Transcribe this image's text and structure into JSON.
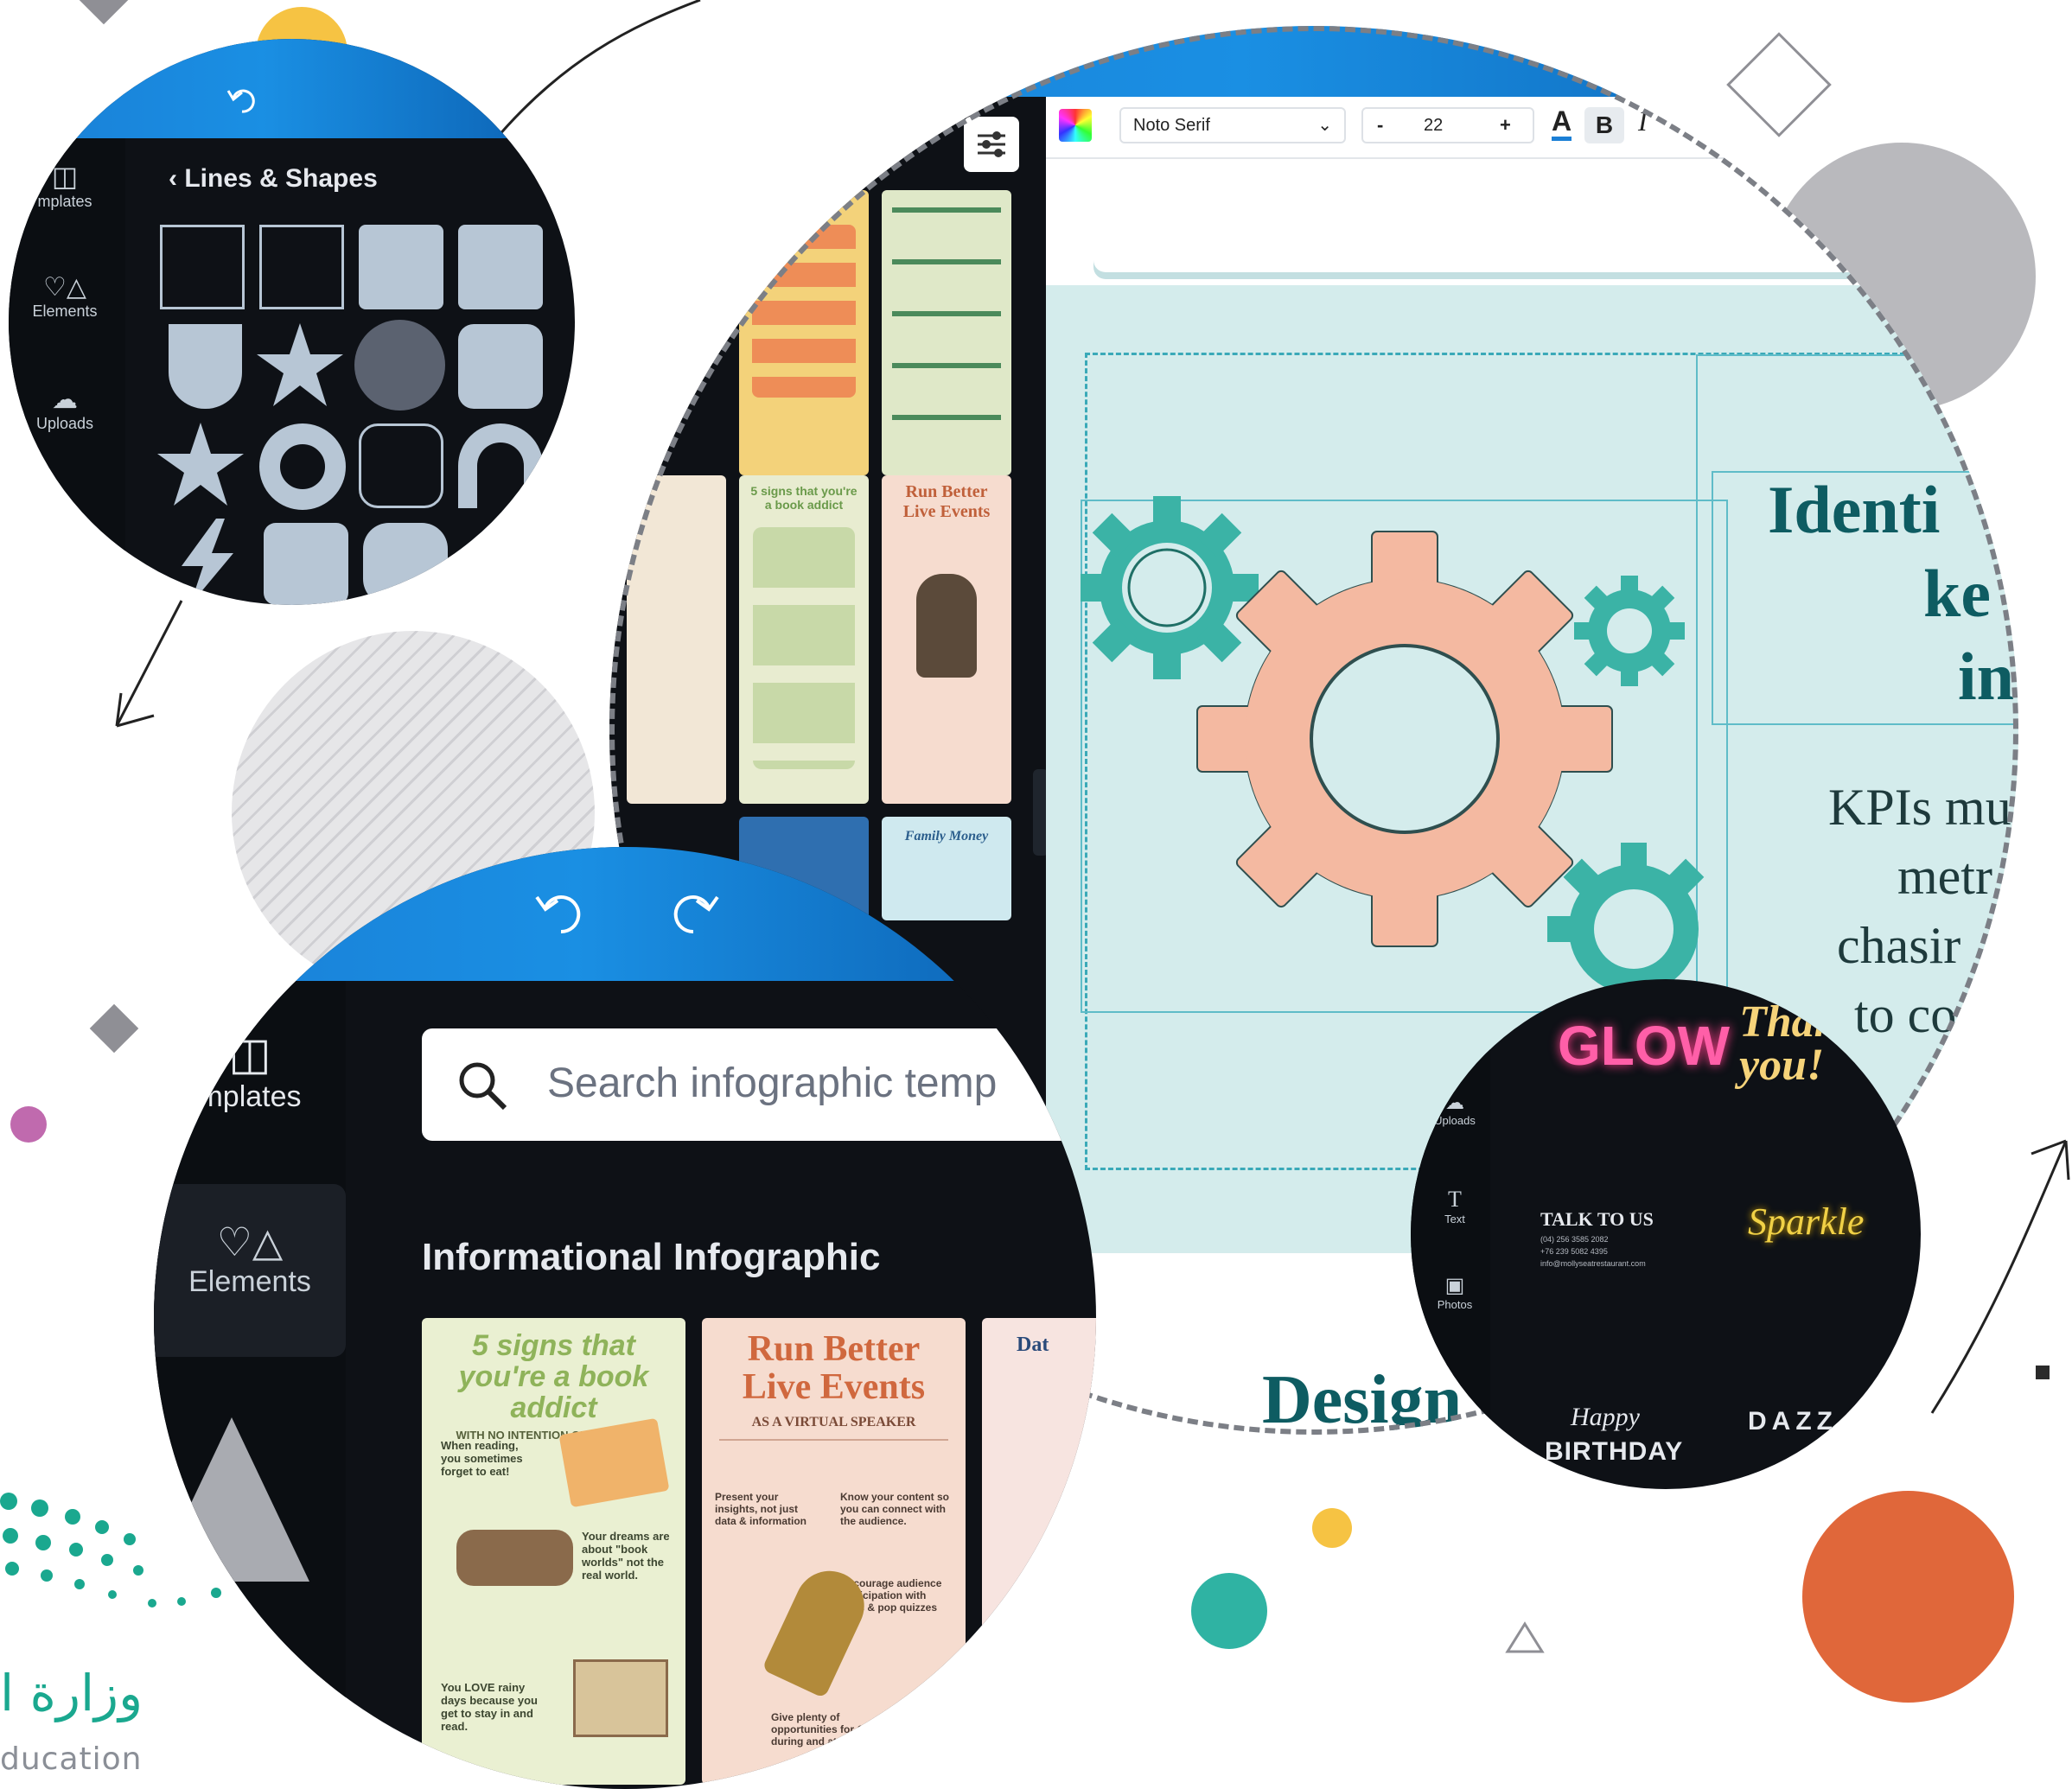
{
  "lines_shapes_panel": {
    "back_label": "Lines & Shapes",
    "sidebar": [
      {
        "label": "mplates",
        "icon": "templates-icon"
      },
      {
        "label": "Elements",
        "icon": "elements-icon"
      },
      {
        "label": "Uploads",
        "icon": "uploads-icon"
      }
    ]
  },
  "editor": {
    "toolbar": {
      "font": "Noto Serif",
      "size": "22",
      "minus": "-",
      "plus": "+",
      "text_color": "A",
      "bold": "B",
      "italic": "I"
    },
    "text_lines": [
      "Identi",
      "ke",
      "in"
    ],
    "body_lines": [
      "KPIs mu",
      "metr",
      "chasir",
      "to co"
    ],
    "bottom_heading": "Design",
    "thumbs": [
      {
        "lines": [
          "5 signs that you're",
          "a book addict"
        ]
      },
      {
        "lines": [
          "Run Better",
          "Live Events"
        ]
      },
      {
        "lines": [
          "Family Money"
        ]
      }
    ]
  },
  "templates_panel": {
    "search_placeholder": "Search infographic temp",
    "section_title": "Informational Infographic",
    "sidebar": [
      {
        "label": "mplates",
        "icon": "templates-icon"
      },
      {
        "label": "Elements",
        "icon": "elements-icon"
      }
    ],
    "cards": [
      {
        "title": "5 signs that you're a book addict",
        "subtitle": "WITH NO INTENTION OF CHANGING",
        "texts": [
          "When reading, you sometimes forget to eat!",
          "Your dreams are about \"book worlds\" not the real world.",
          "You LOVE rainy days because you get to stay in and read."
        ]
      },
      {
        "title": "Run Better Live Events",
        "subtitle": "AS A VIRTUAL SPEAKER",
        "texts": [
          "Present your insights, not just data & information",
          "Know your content so you can connect with the audience.",
          "Encourage audience participation with polls & pop quizzes",
          "Give plenty of opportunities for Q&A during and at the end"
        ]
      },
      {
        "title": "Dat",
        "subtitle": "",
        "texts": []
      }
    ]
  },
  "text_panel": {
    "sidebar": [
      {
        "label": "Uploads",
        "icon": "uploads-icon"
      },
      {
        "label": "Text",
        "icon": "text-icon"
      },
      {
        "label": "Photos",
        "icon": "photos-icon"
      }
    ],
    "styles": [
      "GLOW",
      "Thank you!",
      "TALK TO US",
      "Sparkle",
      "Happy",
      "BIRTHDAY",
      "DAZZ"
    ],
    "talk_lines": [
      "(04) 256 3585 2082",
      "+76 239 5082 4395",
      "info@mollyseatrestaurant.com"
    ]
  },
  "logo": {
    "arabic": "وزارة ا",
    "english": "ducation"
  },
  "colors": {
    "accent_blue": "#1a7fd6",
    "teal": "#2fb3a3",
    "orange": "#e0673a",
    "yellow": "#f6c343",
    "gray": "#b9b9bd",
    "gear_peach": "#f4b9a1"
  }
}
